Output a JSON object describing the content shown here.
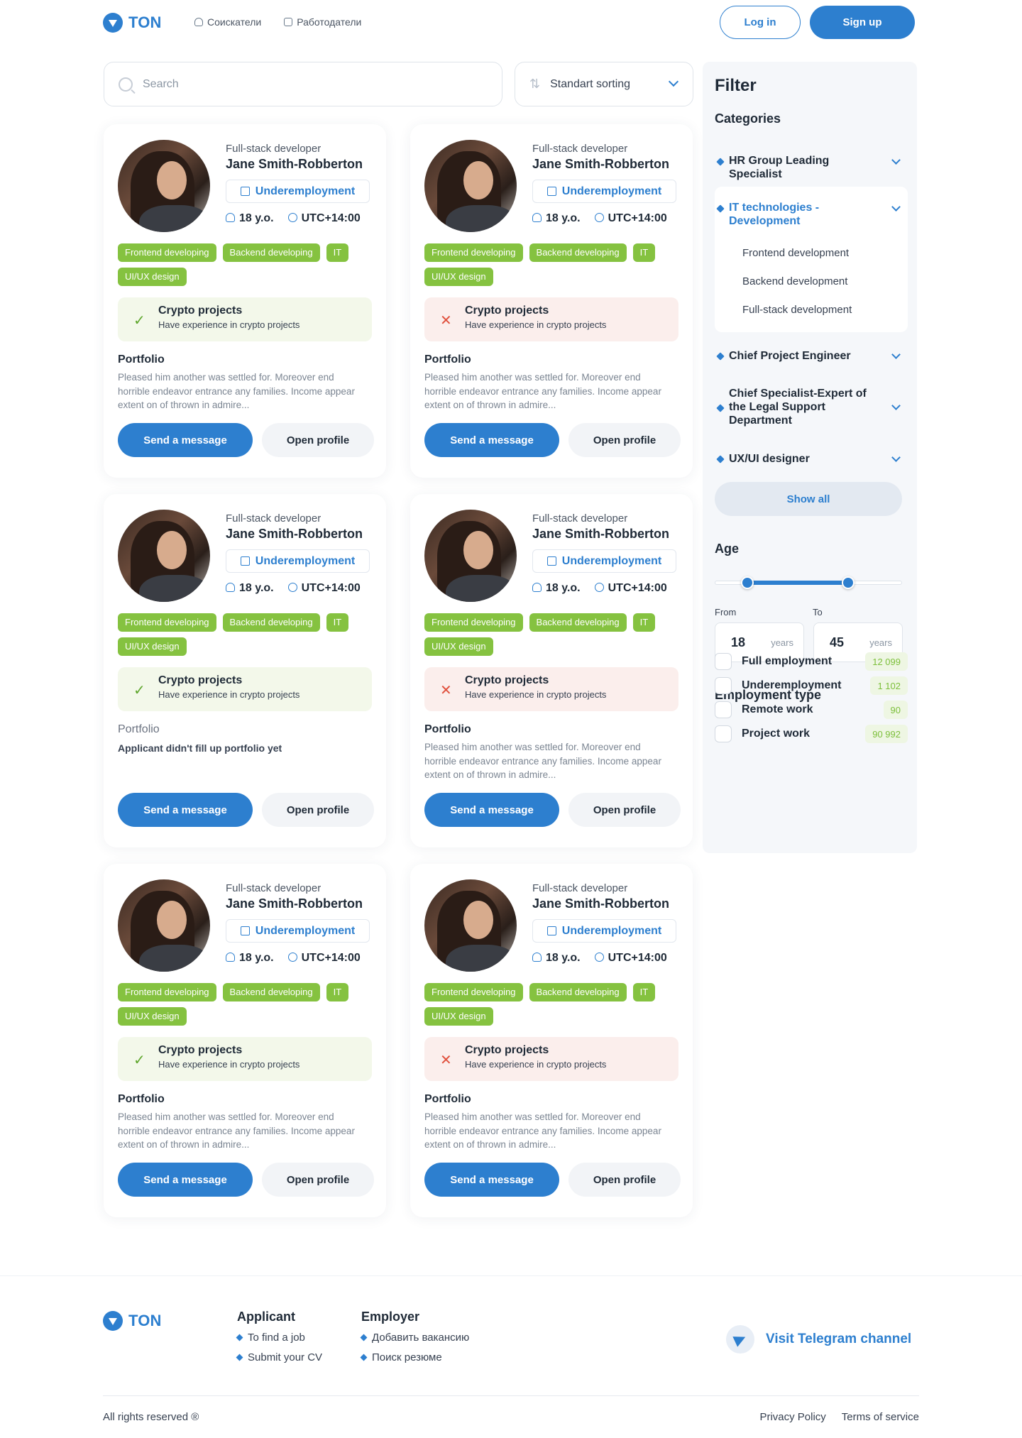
{
  "header": {
    "logo_text": "TON",
    "nav": [
      "Соискатели",
      "Работодатели"
    ],
    "login_label": "Log in",
    "signup_label": "Sign up"
  },
  "search": {
    "placeholder": "Search"
  },
  "sort": {
    "label": "Standart sorting"
  },
  "cards": [
    {
      "role": "Full-stack developer",
      "name": "Jane Smith-Robberton",
      "employment": "Underemployment",
      "age": "18 y.o.",
      "timezone": "UTC+14:00",
      "tags": [
        "Frontend developing",
        "Backend developing",
        "IT",
        "UI/UX design"
      ],
      "crypto_status": "ok",
      "crypto_title": "Crypto projects",
      "crypto_sub": "Have experience in crypto projects",
      "portfolio_title": "Portfolio",
      "portfolio_text": "Pleased him another was settled for. Moreover end horrible endeavor entrance any families. Income appear extent on of thrown in admire...",
      "send_label": "Send a message",
      "profile_label": "Open profile"
    },
    {
      "role": "Full-stack developer",
      "name": "Jane Smith-Robberton",
      "employment": "Underemployment",
      "age": "18 y.o.",
      "timezone": "UTC+14:00",
      "tags": [
        "Frontend developing",
        "Backend developing",
        "IT",
        "UI/UX design"
      ],
      "crypto_status": "no",
      "crypto_title": "Crypto projects",
      "crypto_sub": "Have experience in crypto projects",
      "portfolio_title": "Portfolio",
      "portfolio_text": "Pleased him another was settled for. Moreover end horrible endeavor entrance any families. Income appear extent on of thrown in admire...",
      "send_label": "Send a message",
      "profile_label": "Open profile"
    },
    {
      "role": "Full-stack developer",
      "name": "Jane Smith-Robberton",
      "employment": "Underemployment",
      "age": "18 y.o.",
      "timezone": "UTC+14:00",
      "tags": [
        "Frontend developing",
        "Backend developing",
        "IT",
        "UI/UX design"
      ],
      "crypto_status": "ok",
      "crypto_title": "Crypto projects",
      "crypto_sub": "Have experience in crypto projects",
      "portfolio_title": "Portfolio",
      "portfolio_empty": "Applicant didn't fill up portfolio yet",
      "send_label": "Send a message",
      "profile_label": "Open profile"
    },
    {
      "role": "Full-stack developer",
      "name": "Jane Smith-Robberton",
      "employment": "Underemployment",
      "age": "18 y.o.",
      "timezone": "UTC+14:00",
      "tags": [
        "Frontend developing",
        "Backend developing",
        "IT",
        "UI/UX design"
      ],
      "crypto_status": "no",
      "crypto_title": "Crypto projects",
      "crypto_sub": "Have experience in crypto projects",
      "portfolio_title": "Portfolio",
      "portfolio_text": "Pleased him another was settled for. Moreover end horrible endeavor entrance any families. Income appear extent on of thrown in admire...",
      "send_label": "Send a message",
      "profile_label": "Open profile"
    },
    {
      "role": "Full-stack developer",
      "name": "Jane Smith-Robberton",
      "employment": "Underemployment",
      "age": "18 y.o.",
      "timezone": "UTC+14:00",
      "tags": [
        "Frontend developing",
        "Backend developing",
        "IT",
        "UI/UX design"
      ],
      "crypto_status": "ok",
      "crypto_title": "Crypto projects",
      "crypto_sub": "Have experience in crypto projects",
      "portfolio_title": "Portfolio",
      "portfolio_text": "Pleased him another was settled for. Moreover end horrible endeavor entrance any families. Income appear extent on of thrown in admire...",
      "send_label": "Send a message",
      "profile_label": "Open profile"
    },
    {
      "role": "Full-stack developer",
      "name": "Jane Smith-Robberton",
      "employment": "Underemployment",
      "age": "18 y.o.",
      "timezone": "UTC+14:00",
      "tags": [
        "Frontend developing",
        "Backend developing",
        "IT",
        "UI/UX design"
      ],
      "crypto_status": "no",
      "crypto_title": "Crypto projects",
      "crypto_sub": "Have experience in crypto projects",
      "portfolio_title": "Portfolio",
      "portfolio_text": "Pleased him another was settled for. Moreover end horrible endeavor entrance any families. Income appear extent on of thrown in admire...",
      "send_label": "Send a message",
      "profile_label": "Open profile"
    }
  ],
  "filter": {
    "title": "Filter",
    "categories_title": "Categories",
    "categories": [
      {
        "label": "HR Group Leading Specialist"
      },
      {
        "label": "IT technologies - Development",
        "open": true,
        "children": [
          "Frontend development",
          "Backend development",
          "Full-stack development"
        ]
      },
      {
        "label": "Chief Project Engineer"
      },
      {
        "label": "Chief Specialist-Expert of the Legal Support Department"
      },
      {
        "label": "UX/UI designer"
      }
    ],
    "show_all_label": "Show all",
    "age_title": "Age",
    "age_from_label": "From",
    "age_to_label": "To",
    "age_from": "18",
    "age_to": "45",
    "age_unit": "years",
    "age_slider_fraction": {
      "from": 0.17,
      "to": 0.71
    },
    "employment_title": "Employment type",
    "employment": [
      {
        "label": "Full employment",
        "count": "12 099"
      },
      {
        "label": "Underemployment",
        "count": "1 102"
      },
      {
        "label": "Remote work",
        "count": "90"
      },
      {
        "label": "Project work",
        "count": "90 992"
      }
    ]
  },
  "footer": {
    "logo_text": "TON",
    "applicant_title": "Applicant",
    "applicant_links": [
      "To find a job",
      "Submit your CV"
    ],
    "employer_title": "Employer",
    "employer_links": [
      "Добавить вакансию",
      "Поиск резюме"
    ],
    "telegram_label": "Visit Telegram channel",
    "copyright": "All rights reserved ®",
    "privacy": "Privacy Policy",
    "terms": "Terms of service"
  },
  "colors": {
    "accent": "#2d7fcf",
    "tag_green": "#85c240",
    "ok_bg": "#f3f8ea",
    "no_bg": "#fbeeec"
  }
}
